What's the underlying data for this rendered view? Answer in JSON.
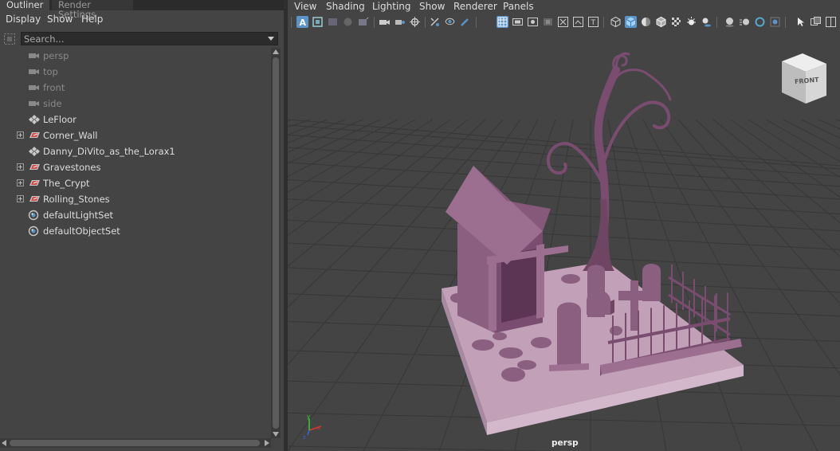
{
  "outliner": {
    "tabs": [
      "Outliner",
      "Render Settings"
    ],
    "menu": [
      "Display",
      "Show",
      "Help"
    ],
    "search": {
      "placeholder": "Search...",
      "value": ""
    },
    "items": [
      {
        "label": "persp",
        "icon": "camera-icon",
        "expandable": false,
        "dim": true
      },
      {
        "label": "top",
        "icon": "camera-icon",
        "expandable": false,
        "dim": true
      },
      {
        "label": "front",
        "icon": "camera-icon",
        "expandable": false,
        "dim": true
      },
      {
        "label": "side",
        "icon": "camera-icon",
        "expandable": false,
        "dim": true
      },
      {
        "label": "LeFloor",
        "icon": "mesh-transform-icon",
        "expandable": false,
        "dim": false
      },
      {
        "label": "Corner_Wall",
        "icon": "group-icon",
        "expandable": true,
        "dim": false
      },
      {
        "label": "Danny_DiVito_as_the_Lorax1",
        "icon": "mesh-transform-icon",
        "expandable": false,
        "dim": false
      },
      {
        "label": "Gravestones",
        "icon": "group-icon",
        "expandable": true,
        "dim": false
      },
      {
        "label": "The_Crypt",
        "icon": "group-icon",
        "expandable": true,
        "dim": false
      },
      {
        "label": "Rolling_Stones",
        "icon": "group-icon",
        "expandable": true,
        "dim": false
      },
      {
        "label": "defaultLightSet",
        "icon": "set-icon",
        "expandable": false,
        "dim": false
      },
      {
        "label": "defaultObjectSet",
        "icon": "set-icon",
        "expandable": false,
        "dim": false
      }
    ]
  },
  "viewport": {
    "menu": [
      "View",
      "Shading",
      "Lighting",
      "Show",
      "Renderer",
      "Panels"
    ],
    "camera_label": "persp",
    "view_cube_label": "FRONT",
    "axis_labels": {
      "x": "x",
      "y": "y",
      "z": "z"
    },
    "colors": {
      "background": "#444444",
      "grid": "#3a3a3a",
      "model": "#8b5f80",
      "accent": "#5a94c8"
    }
  }
}
